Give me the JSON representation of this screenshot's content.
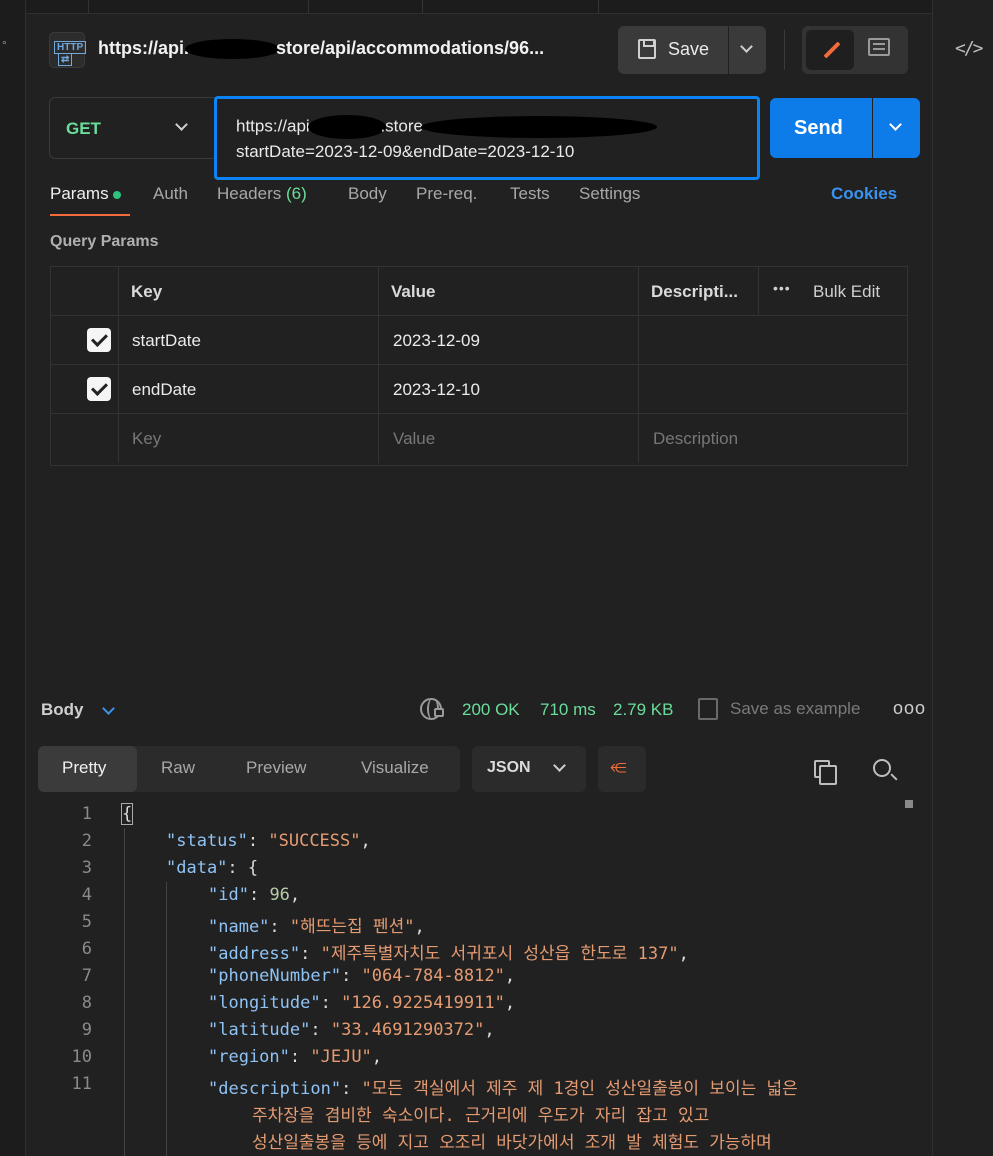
{
  "title": {
    "url_prefix": "https://api.",
    "url_suffix": "store/api/accommodations/96..."
  },
  "toolbar": {
    "save_label": "Save"
  },
  "request": {
    "method": "GET",
    "url_line1_a": "https://api.",
    "url_line1_b": ".store",
    "url_line2": "startDate=2023-12-09&endDate=2023-12-10",
    "send_label": "Send"
  },
  "tabs": {
    "params": "Params",
    "auth": "Auth",
    "headers": "Headers",
    "headers_count": "(6)",
    "body": "Body",
    "prereq": "Pre-req.",
    "tests": "Tests",
    "settings": "Settings",
    "cookies": "Cookies"
  },
  "query_params": {
    "label": "Query Params",
    "headers": {
      "key": "Key",
      "value": "Value",
      "description": "Descripti...",
      "bulk_edit": "Bulk Edit",
      "more": "•••"
    },
    "rows": [
      {
        "key": "startDate",
        "value": "2023-12-09"
      },
      {
        "key": "endDate",
        "value": "2023-12-10"
      }
    ],
    "placeholders": {
      "key": "Key",
      "value": "Value",
      "description": "Description"
    }
  },
  "response": {
    "body_label": "Body",
    "status": "200 OK",
    "time": "710 ms",
    "size": "2.79 KB",
    "save_example": "Save as example",
    "more": "ooo",
    "views": [
      "Pretty",
      "Raw",
      "Preview",
      "Visualize"
    ],
    "format": "JSON"
  },
  "code": {
    "line_numbers": [
      "1",
      "2",
      "3",
      "4",
      "5",
      "6",
      "7",
      "8",
      "9",
      "10",
      "11"
    ],
    "open_brace": "{",
    "status_key": "\"status\"",
    "status_val": "\"SUCCESS\"",
    "data_key": "\"data\"",
    "id_key": "\"id\"",
    "id_val": "96",
    "name_key": "\"name\"",
    "name_val": "\"해뜨는집 펜션\"",
    "address_key": "\"address\"",
    "address_val": "\"제주특별자치도 서귀포시 성산읍 한도로 137\"",
    "phone_key": "\"phoneNumber\"",
    "phone_val": "\"064-784-8812\"",
    "longitude_key": "\"longitude\"",
    "longitude_val": "\"126.9225419911\"",
    "latitude_key": "\"latitude\"",
    "latitude_val": "\"33.4691290372\"",
    "region_key": "\"region\"",
    "region_val": "\"JEJU\"",
    "desc_key": "\"description\"",
    "desc_line1": "\"모든 객실에서 제주 제 1경인 성산일출봉이 보이는 넓은",
    "desc_line2": "주차장을 겸비한 숙소이다. 근거리에 우도가 자리 잡고 있고",
    "desc_line3": "성산일출봉을 등에 지고 오조리 바닷가에서 조개 발 체험도 가능하며"
  }
}
